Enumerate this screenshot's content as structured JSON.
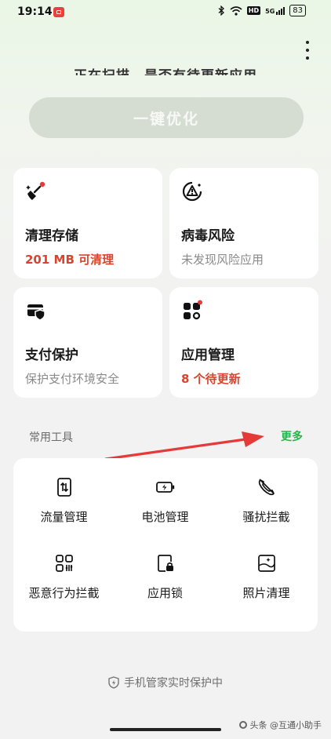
{
  "status_bar": {
    "time": "19:14",
    "network": "5G",
    "hd_label": "HD",
    "battery": "83"
  },
  "header": {
    "scan_status": "正在扫描，是否有待更新应用",
    "optimize_label": "一键优化"
  },
  "cards": {
    "clean": {
      "title": "清理存储",
      "sub": "201 MB 可清理",
      "icon": "broom-icon"
    },
    "virus": {
      "title": "病毒风险",
      "sub": "未发现风险应用",
      "icon": "virus-alert-icon"
    },
    "pay": {
      "title": "支付保护",
      "sub": "保护支付环境安全",
      "icon": "payment-card-icon"
    },
    "apps": {
      "title": "应用管理",
      "sub": "8 个待更新",
      "icon": "app-grid-icon"
    }
  },
  "tools": {
    "heading": "常用工具",
    "more_label": "更多",
    "items": [
      {
        "label": "流量管理",
        "icon": "data-traffic-icon"
      },
      {
        "label": "电池管理",
        "icon": "battery-icon"
      },
      {
        "label": "骚扰拦截",
        "icon": "call-block-icon"
      },
      {
        "label": "恶意行为拦截",
        "icon": "behavior-block-icon"
      },
      {
        "label": "应用锁",
        "icon": "app-lock-icon"
      },
      {
        "label": "照片清理",
        "icon": "photo-clean-icon"
      }
    ]
  },
  "footer": {
    "protection_status": "手机管家实时保护中"
  },
  "watermark": {
    "text": "头条 @互通小助手"
  },
  "colors": {
    "accent_green": "#2bb24c",
    "alert_red": "#d8452f",
    "arrow_red": "#e53a3a"
  }
}
